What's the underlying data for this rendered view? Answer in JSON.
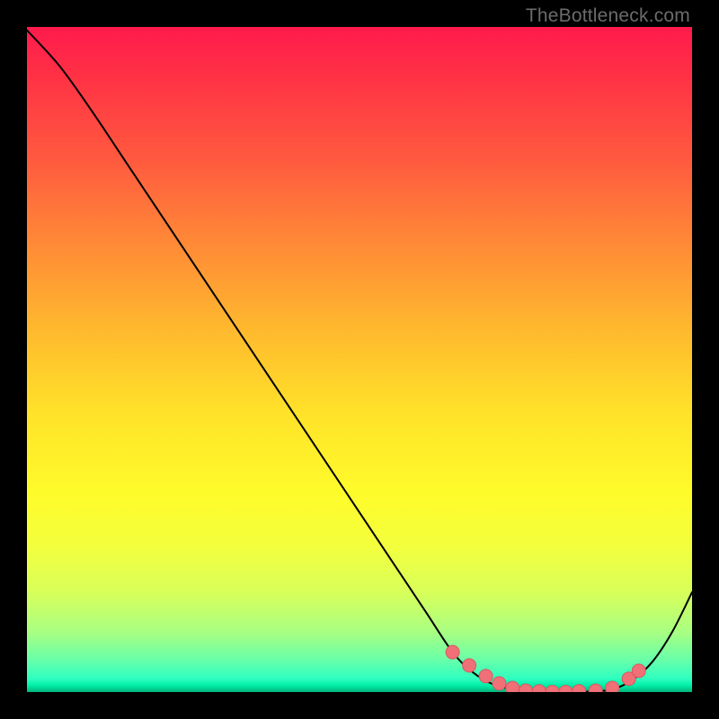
{
  "watermark": "TheBottleneck.com",
  "colors": {
    "background": "#000000",
    "curve": "#000000",
    "dot_fill": "#f07078",
    "dot_stroke": "#d85860"
  },
  "chart_data": {
    "type": "line",
    "title": "",
    "xlabel": "",
    "ylabel": "",
    "xlim": [
      0,
      1
    ],
    "ylim": [
      0,
      1
    ],
    "series": [
      {
        "name": "curve",
        "x": [
          0.0,
          0.05,
          0.1,
          0.15,
          0.2,
          0.25,
          0.3,
          0.35,
          0.4,
          0.45,
          0.5,
          0.55,
          0.6,
          0.64,
          0.67,
          0.7,
          0.73,
          0.76,
          0.79,
          0.82,
          0.85,
          0.88,
          0.91,
          0.94,
          0.97,
          1.0
        ],
        "y": [
          0.995,
          0.94,
          0.87,
          0.795,
          0.72,
          0.645,
          0.57,
          0.495,
          0.42,
          0.345,
          0.27,
          0.195,
          0.12,
          0.06,
          0.03,
          0.012,
          0.004,
          0.001,
          0.0,
          0.0,
          0.001,
          0.004,
          0.018,
          0.045,
          0.09,
          0.15
        ]
      }
    ],
    "dots": {
      "x": [
        0.64,
        0.665,
        0.69,
        0.71,
        0.73,
        0.75,
        0.77,
        0.79,
        0.81,
        0.83,
        0.855,
        0.88,
        0.905,
        0.92
      ],
      "y": [
        0.06,
        0.04,
        0.024,
        0.013,
        0.006,
        0.002,
        0.001,
        0.0,
        0.0,
        0.001,
        0.002,
        0.006,
        0.02,
        0.032
      ]
    }
  }
}
